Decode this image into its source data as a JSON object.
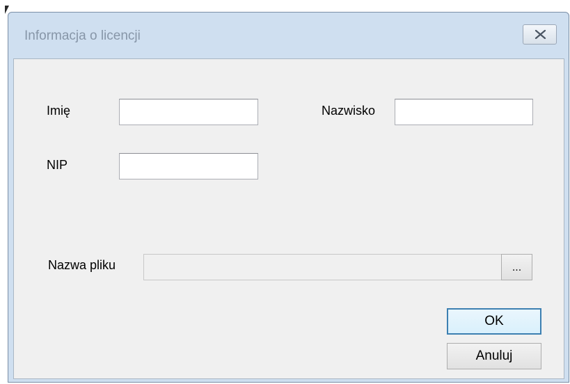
{
  "window": {
    "title": "Informacja o licencji",
    "close_icon": "close-x-icon"
  },
  "form": {
    "first_name_label": "Imię",
    "first_name_value": "",
    "last_name_label": "Nazwisko",
    "last_name_value": "",
    "nip_label": "NIP",
    "nip_value": "",
    "file_name_label": "Nazwa pliku",
    "file_name_value": "",
    "file_name_enabled": false,
    "browse_label": "..."
  },
  "buttons": {
    "ok_label": "OK",
    "cancel_label": "Anuluj"
  },
  "colors": {
    "frame": "#cfdff0",
    "client": "#f0f0f0",
    "default_button_border": "#3c7fb1"
  }
}
